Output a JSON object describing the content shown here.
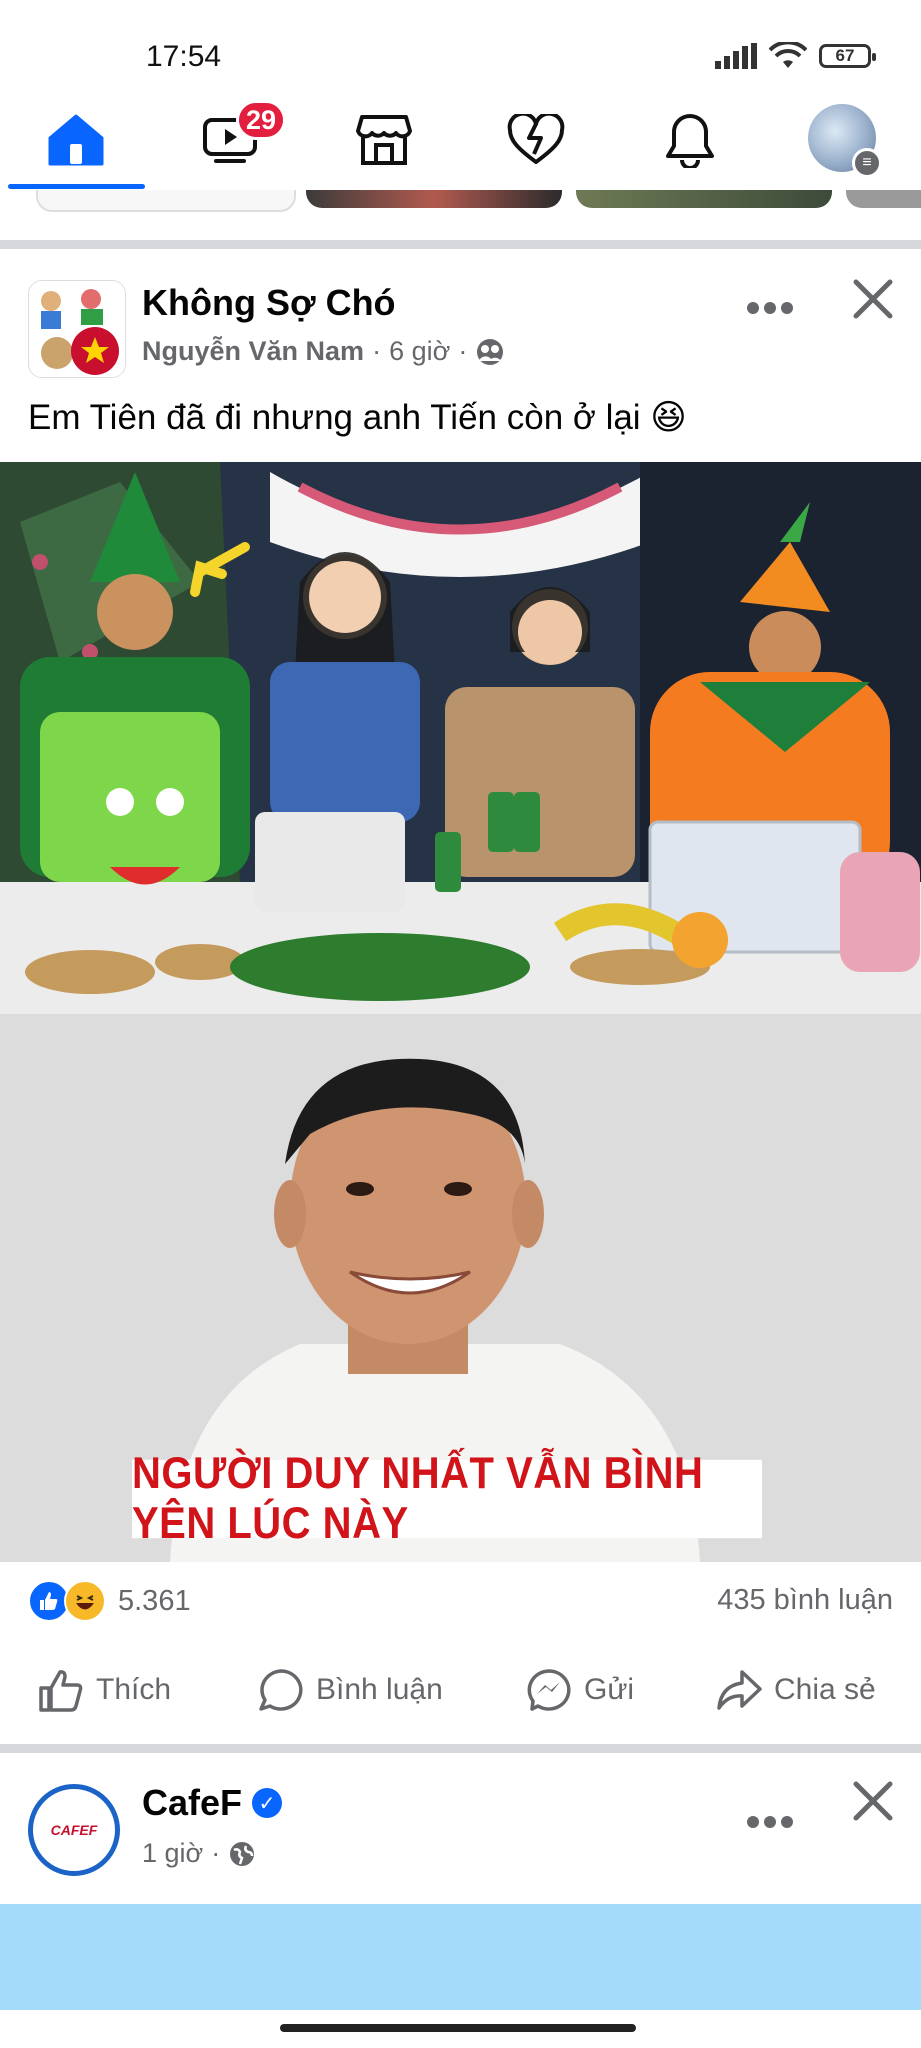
{
  "status_bar": {
    "time": "17:54",
    "battery": "67"
  },
  "nav": {
    "video_badge": "29",
    "items": [
      "home-icon",
      "video-icon",
      "marketplace-icon",
      "dating-icon",
      "notifications-icon",
      "profile-menu"
    ]
  },
  "post1": {
    "page_name": "Không Sợ Chó",
    "author": "Nguyễn Văn Nam",
    "time": "6 giờ",
    "separator": "·",
    "caption": "Em Tiên đã đi nhưng anh Tiến còn ở lại 😆",
    "banner_text": "NGƯỜI DUY NHẤT VẪN BÌNH YÊN LÚC NÀY",
    "reactions_count": "5.361",
    "comments_count": "435 bình luận",
    "actions": {
      "like": "Thích",
      "comment": "Bình luận",
      "send": "Gửi",
      "share": "Chia sẻ"
    }
  },
  "post2": {
    "page_name": "CafeF",
    "time": "1 giờ",
    "separator": "·",
    "logo_text": "CAFEF"
  },
  "colors": {
    "accent": "#0866ff",
    "badge": "#e41e3f",
    "banner_text": "#d0141a",
    "ad_bar": "#a4dafa"
  }
}
